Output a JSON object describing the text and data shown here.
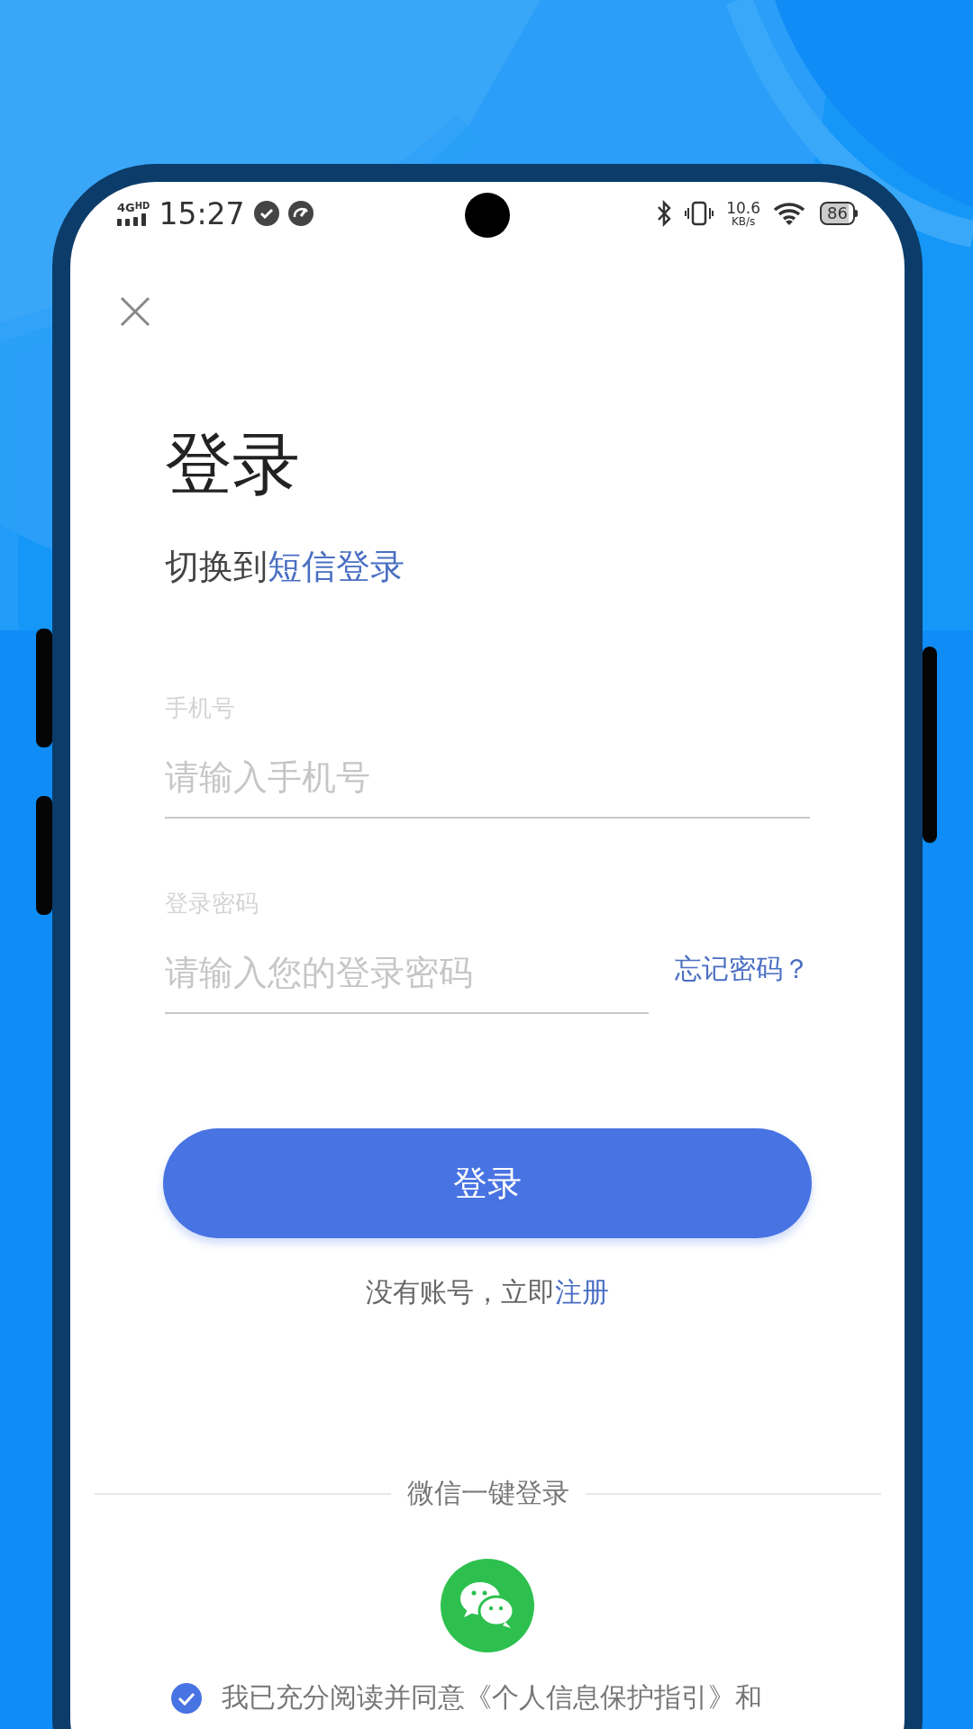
{
  "status_bar": {
    "network": "4G",
    "network_badge": "HD",
    "time": "15:27",
    "speed": "10.6",
    "speed_unit": "KB/s",
    "battery": "86"
  },
  "title": "登录",
  "switch": {
    "text": "切换到",
    "link": "短信登录"
  },
  "fields": [
    {
      "label": "手机号",
      "placeholder": "请输入手机号"
    },
    {
      "label": "登录密码",
      "placeholder": "请输入您的登录密码",
      "action": "忘记密码？"
    }
  ],
  "login_button": "登录",
  "register": {
    "text": "没有账号，立即",
    "link": "注册"
  },
  "wechat_label": "微信一键登录",
  "agreement": {
    "checked": true,
    "text": "我已充分阅读并同意",
    "link": "《个人信息保护指引》",
    "after": "和"
  }
}
